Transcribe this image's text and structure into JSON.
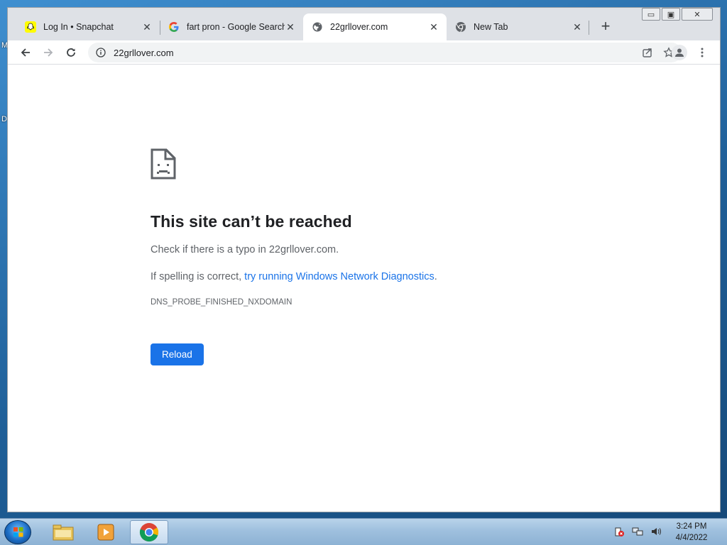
{
  "desktop": {
    "edge_letters": [
      "M",
      "D"
    ]
  },
  "browser": {
    "tabs": [
      {
        "title": "Log In • Snapchat",
        "icon": "snapchat-icon",
        "active": false
      },
      {
        "title": "fart pron - Google Search",
        "icon": "google-icon",
        "active": false
      },
      {
        "title": "22grllover.com",
        "icon": "globe-icon",
        "active": true
      },
      {
        "title": "New Tab",
        "icon": "chrome-icon",
        "active": false
      }
    ],
    "new_tab_symbol": "+",
    "close_symbol": "✕",
    "window_controls": {
      "minimize": "▭",
      "maximize": "▣",
      "close": "✕"
    },
    "address": {
      "url": "22grllover.com"
    }
  },
  "error_page": {
    "title": "This site can’t be reached",
    "typo_prefix": "Check if there is a typo in ",
    "typo_domain": "22grllover.com",
    "typo_suffix": ".",
    "spelling_prefix": "If spelling is correct, ",
    "diagnostics_link": "try running Windows Network Diagnostics",
    "spelling_suffix": ".",
    "error_code": "DNS_PROBE_FINISHED_NXDOMAIN",
    "reload_label": "Reload"
  },
  "taskbar": {
    "pinned": [
      "file-explorer-icon",
      "media-player-icon",
      "chrome-icon"
    ],
    "active_item": "chrome-icon",
    "clock_time": "3:24 PM",
    "clock_date": "4/4/2022"
  },
  "colors": {
    "accent": "#1a73e8",
    "tabstrip": "#dee1e6",
    "omnibox": "#f1f3f4"
  }
}
